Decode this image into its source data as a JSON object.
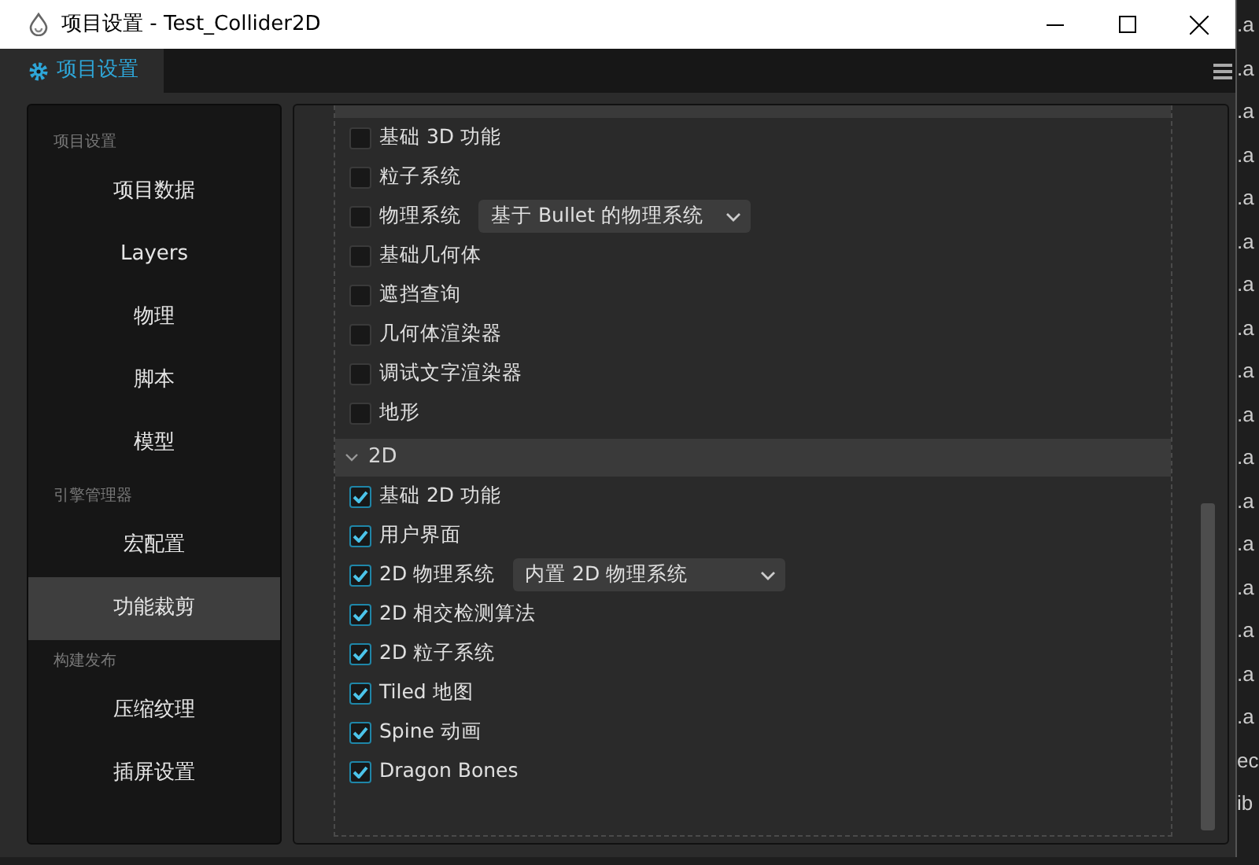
{
  "window": {
    "title": "项目设置 - Test_Collider2D"
  },
  "tabs": [
    {
      "label": "项目设置",
      "selected": true
    }
  ],
  "sidebar": {
    "groups": [
      {
        "title": "项目设置",
        "items": [
          {
            "label": "项目数据",
            "selected": false
          },
          {
            "label": "Layers",
            "selected": false
          },
          {
            "label": "物理",
            "selected": false
          },
          {
            "label": "脚本",
            "selected": false
          },
          {
            "label": "模型",
            "selected": false
          }
        ]
      },
      {
        "title": "引擎管理器",
        "items": [
          {
            "label": "宏配置",
            "selected": false
          },
          {
            "label": "功能裁剪",
            "selected": true
          }
        ]
      },
      {
        "title": "构建发布",
        "items": [
          {
            "label": "压缩纹理",
            "selected": false
          },
          {
            "label": "插屏设置",
            "selected": false
          }
        ]
      }
    ]
  },
  "sections": [
    {
      "items": [
        {
          "kind": "checkbox",
          "label": "基础 3D 功能",
          "checked": false
        },
        {
          "kind": "checkbox",
          "label": "粒子系统",
          "checked": false
        },
        {
          "kind": "select",
          "label": "物理系统",
          "checked": false,
          "value": "基于 Bullet 的物理系统"
        },
        {
          "kind": "checkbox",
          "label": "基础几何体",
          "checked": false
        },
        {
          "kind": "checkbox",
          "label": "遮挡查询",
          "checked": false
        },
        {
          "kind": "checkbox",
          "label": "几何体渲染器",
          "checked": false
        },
        {
          "kind": "checkbox",
          "label": "调试文字渲染器",
          "checked": false
        },
        {
          "kind": "checkbox",
          "label": "地形",
          "checked": false
        }
      ]
    },
    {
      "title": "2D",
      "expanded": true,
      "items": [
        {
          "kind": "checkbox",
          "label": "基础 2D 功能",
          "checked": true
        },
        {
          "kind": "checkbox",
          "label": "用户界面",
          "checked": true
        },
        {
          "kind": "select",
          "label": "2D 物理系统",
          "checked": true,
          "value": "内置 2D 物理系统"
        },
        {
          "kind": "checkbox",
          "label": "2D 相交检测算法",
          "checked": true
        },
        {
          "kind": "checkbox",
          "label": "2D 粒子系统",
          "checked": true
        },
        {
          "kind": "checkbox",
          "label": "Tiled 地图",
          "checked": true
        },
        {
          "kind": "checkbox",
          "label": "Spine 动画",
          "checked": true
        },
        {
          "kind": "checkbox",
          "label": "Dragon Bones",
          "checked": true
        }
      ]
    }
  ],
  "background_window": {
    "fragments": [
      ".a",
      ".a",
      ".a",
      ".a",
      ".a",
      ".a",
      ".a",
      ".a",
      ".a",
      ".a",
      ".a",
      ".a",
      ".a",
      ".a",
      ".a",
      ".a",
      ".a",
      "ec",
      "ib"
    ]
  }
}
